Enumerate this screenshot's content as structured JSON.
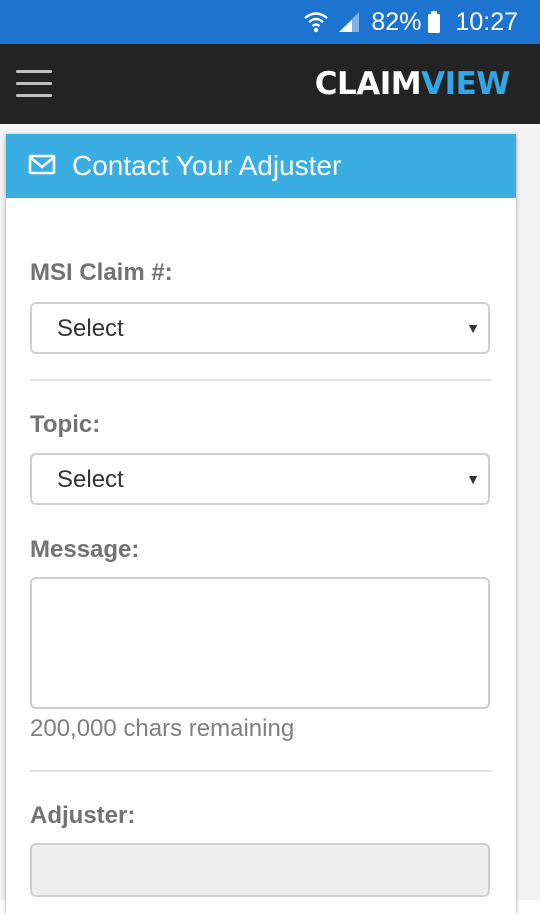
{
  "status_bar": {
    "battery": "82%",
    "time": "10:27",
    "icons": [
      "wifi-icon",
      "signal-icon",
      "battery-icon"
    ]
  },
  "app_bar": {
    "logo_part1": "CLAIM",
    "logo_part2": "VIEW",
    "menu_icon": "hamburger-menu-icon"
  },
  "card": {
    "title": "Contact Your Adjuster",
    "icon": "mail-icon"
  },
  "form": {
    "claim_label": "MSI Claim #:",
    "claim_value": "Select",
    "topic_label": "Topic:",
    "topic_value": "Select",
    "message_label": "Message:",
    "message_value": "",
    "chars_remaining": "200,000 chars remaining",
    "adjuster_label": "Adjuster:",
    "adjuster_value": ""
  },
  "colors": {
    "status_bar": "#1c74d0",
    "app_bar": "#232323",
    "header": "#3aaee2",
    "logo_accent": "#33a7e6"
  }
}
